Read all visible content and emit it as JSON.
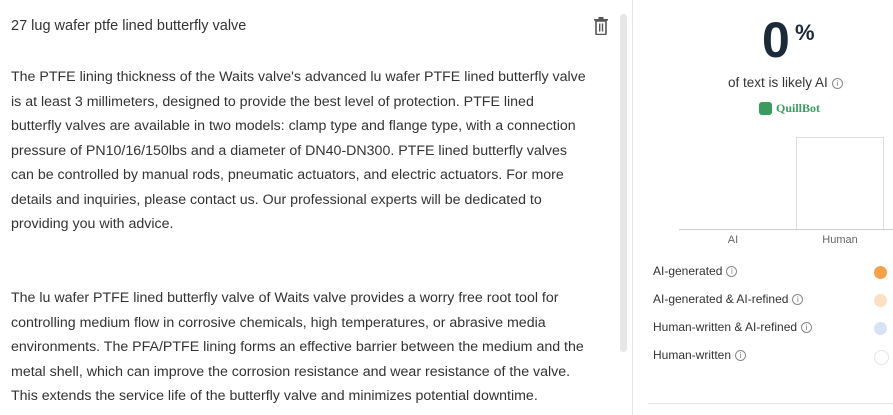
{
  "document": {
    "title": "27 lug wafer ptfe lined butterfly valve",
    "paragraphs": [
      "The PTFE lining thickness of the Waits valve's advanced lu wafer PTFE lined butterfly valve is at least 3 millimeters, designed to provide the best level of protection. PTFE lined butterfly valves are available in two models: clamp type and flange type, with a connection pressure of PN10/16/150lbs and a diameter of DN40-DN300. PTFE lined butterfly valves can be controlled by manual rods, pneumatic actuators, and electric actuators. For more details and inquiries, please contact us. Our professional experts will be dedicated to providing you with advice.",
      "The lu wafer PTFE lined butterfly valve of Waits valve provides a worry free root tool for controlling medium flow in corrosive chemicals, high temperatures, or abrasive media environments. The PFA/PTFE lining forms an effective barrier between the medium and the metal shell, which can improve the corrosion resistance and wear resistance of the valve. This extends the service life of the butterfly valve and minimizes potential downtime."
    ]
  },
  "detector": {
    "score": "0",
    "score_unit": "%",
    "caption": "of text is likely AI",
    "brand": "QuillBot",
    "brand_color": "#3a9b61",
    "chart": {
      "categories": [
        "AI",
        "Human"
      ],
      "values": [
        0,
        100
      ]
    },
    "legend": [
      {
        "label": "AI-generated",
        "color": "#f4a14a"
      },
      {
        "label": "AI-generated & AI-refined",
        "color": "#fbe0c4"
      },
      {
        "label": "Human-written & AI-refined",
        "color": "#d6e2f5"
      },
      {
        "label": "Human-written",
        "color": "#ffffff"
      }
    ]
  }
}
